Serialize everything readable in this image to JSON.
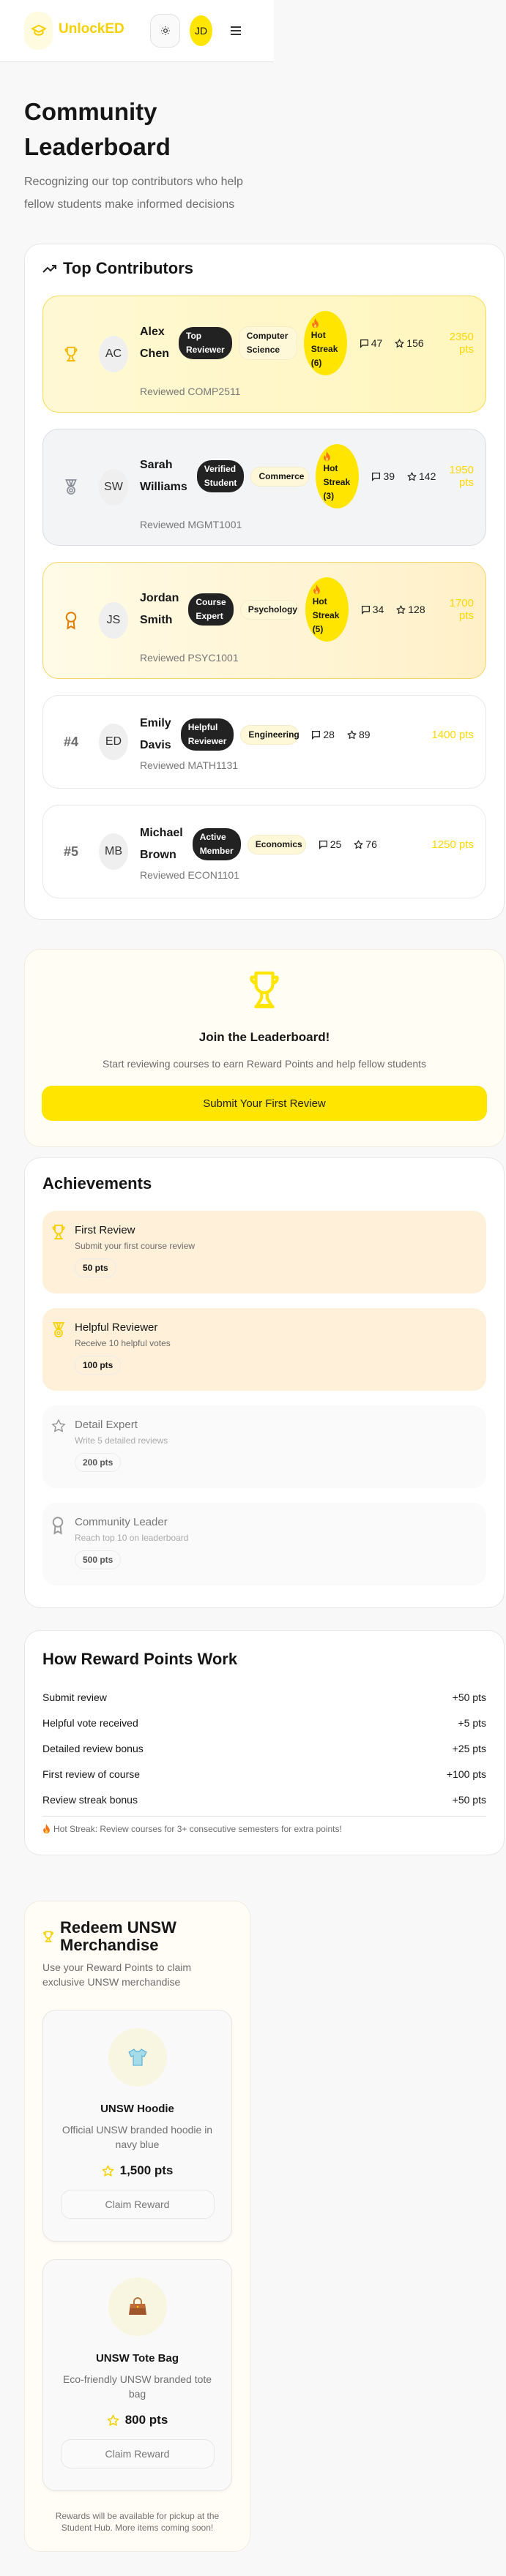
{
  "header": {
    "brand": "UnlockED",
    "avatar_initials": "JD"
  },
  "page": {
    "title": "Community Leaderboard",
    "subtitle": "Recognizing our top contributors who help fellow students make informed decisions"
  },
  "top_contributors": {
    "title": "Top Contributors",
    "rows": [
      {
        "rank": "1",
        "rank_icon": "trophy-icon",
        "initials": "AC",
        "name": "Alex Chen",
        "badge": "Top Reviewer",
        "category": "Computer Science",
        "hot_streak": "Hot Streak (6)",
        "reviews": "47",
        "stars": "156",
        "points": "2350 pts",
        "reviewed": "Reviewed COMP2511"
      },
      {
        "rank": "2",
        "rank_icon": "medal-icon",
        "initials": "SW",
        "name": "Sarah Williams",
        "badge": "Verified Student",
        "category": "Commerce",
        "hot_streak": "Hot Streak (3)",
        "reviews": "39",
        "stars": "142",
        "points": "1950 pts",
        "reviewed": "Reviewed MGMT1001"
      },
      {
        "rank": "3",
        "rank_icon": "award-icon",
        "initials": "JS",
        "name": "Jordan Smith",
        "badge": "Course Expert",
        "category": "Psychology",
        "hot_streak": "Hot Streak (5)",
        "reviews": "34",
        "stars": "128",
        "points": "1700 pts",
        "reviewed": "Reviewed PSYC1001"
      },
      {
        "rank": "#4",
        "initials": "ED",
        "name": "Emily Davis",
        "badge": "Helpful Reviewer",
        "category": "Engineering",
        "reviews": "28",
        "stars": "89",
        "points": "1400 pts",
        "reviewed": "Reviewed MATH1131"
      },
      {
        "rank": "#5",
        "initials": "MB",
        "name": "Michael Brown",
        "badge": "Active Member",
        "category": "Economics",
        "reviews": "25",
        "stars": "76",
        "points": "1250 pts",
        "reviewed": "Reviewed ECON1101"
      }
    ]
  },
  "join": {
    "title": "Join the Leaderboard!",
    "description": "Start reviewing courses to earn Reward Points and help fellow students",
    "button": "Submit Your First Review"
  },
  "achievements": {
    "title": "Achievements",
    "items": [
      {
        "icon": "trophy-icon",
        "title": "First Review",
        "description": "Submit your first course review",
        "points": "50 pts",
        "unlocked": true
      },
      {
        "icon": "medal-icon",
        "title": "Helpful Reviewer",
        "description": "Receive 10 helpful votes",
        "points": "100 pts",
        "unlocked": true
      },
      {
        "icon": "star-icon",
        "title": "Detail Expert",
        "description": "Write 5 detailed reviews",
        "points": "200 pts",
        "unlocked": false
      },
      {
        "icon": "award-icon",
        "title": "Community Leader",
        "description": "Reach top 10 on leaderboard",
        "points": "500 pts",
        "unlocked": false
      }
    ]
  },
  "how_points": {
    "title": "How Reward Points Work",
    "rules": [
      {
        "label": "Submit review",
        "value": "+50 pts"
      },
      {
        "label": "Helpful vote received",
        "value": "+5 pts"
      },
      {
        "label": "Detailed review bonus",
        "value": "+25 pts"
      },
      {
        "label": "First review of course",
        "value": "+100 pts"
      },
      {
        "label": "Review streak bonus",
        "value": "+50 pts"
      }
    ],
    "note": "Hot Streak: Review courses for 3+ consecutive semesters for extra points!"
  },
  "redeem": {
    "title": "Redeem UNSW Merchandise",
    "description": "Use your Reward Points to claim exclusive UNSW merchandise",
    "items": [
      {
        "icon": "tshirt-icon",
        "name": "UNSW Hoodie",
        "description": "Official UNSW branded hoodie in navy blue",
        "points": "1,500 pts",
        "button": "Claim Reward"
      },
      {
        "icon": "handbag-icon",
        "name": "UNSW Tote Bag",
        "description": "Eco-friendly UNSW branded tote bag",
        "points": "800 pts",
        "button": "Claim Reward"
      }
    ],
    "footer": "Rewards will be available for pickup at the Student Hub. More items coming soon!"
  },
  "colors": {
    "accent": "#ffe500",
    "brand": "#f7d000"
  }
}
